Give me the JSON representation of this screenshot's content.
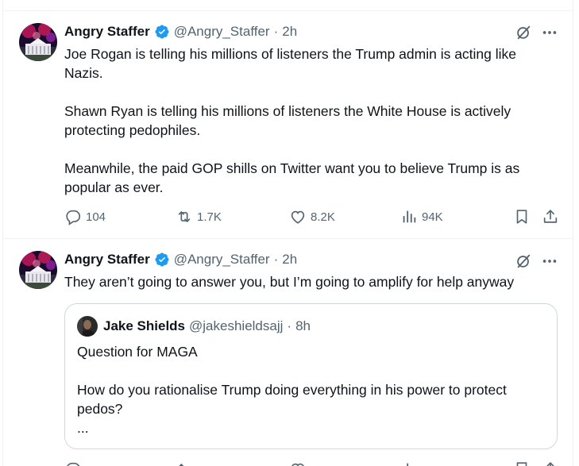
{
  "tweets": [
    {
      "author_name": "Angry Staffer",
      "handle": "@Angry_Staffer",
      "separator": "·",
      "time": "2h",
      "paragraphs": [
        "Joe Rogan is telling his millions of listeners the Trump admin is acting like Nazis.",
        "Shawn Ryan is telling his millions of listeners the White House is actively protecting pedophiles.",
        "Meanwhile, the paid GOP shills on Twitter want you to believe Trump is as popular as ever."
      ],
      "stats": {
        "replies": "104",
        "reposts": "1.7K",
        "likes": "8.2K",
        "views": "94K"
      }
    },
    {
      "author_name": "Angry Staffer",
      "handle": "@Angry_Staffer",
      "separator": "·",
      "time": "2h",
      "paragraphs": [
        "They aren’t going to answer you, but I’m going to amplify for help anyway"
      ],
      "quote": {
        "author_name": "Jake Shields",
        "handle": "@jakeshieldsajj",
        "separator": "·",
        "time": "8h",
        "lines": [
          "Question for MAGA",
          "How do you rationalise Trump doing everything in his power to protect pedos?",
          "..."
        ]
      }
    }
  ],
  "icons": {
    "verified": "verified-badge-icon",
    "grok": "grok-icon",
    "more": "more-dots-icon",
    "reply": "reply-icon",
    "repost": "repost-icon",
    "like": "like-icon",
    "views": "views-icon",
    "bookmark": "bookmark-icon",
    "share": "share-icon"
  },
  "colors": {
    "verified_blue": "#1d9bf0",
    "secondary_text": "#536471",
    "primary_text": "#0f1419",
    "border": "#cfd9de",
    "divider": "#eff3f4"
  }
}
